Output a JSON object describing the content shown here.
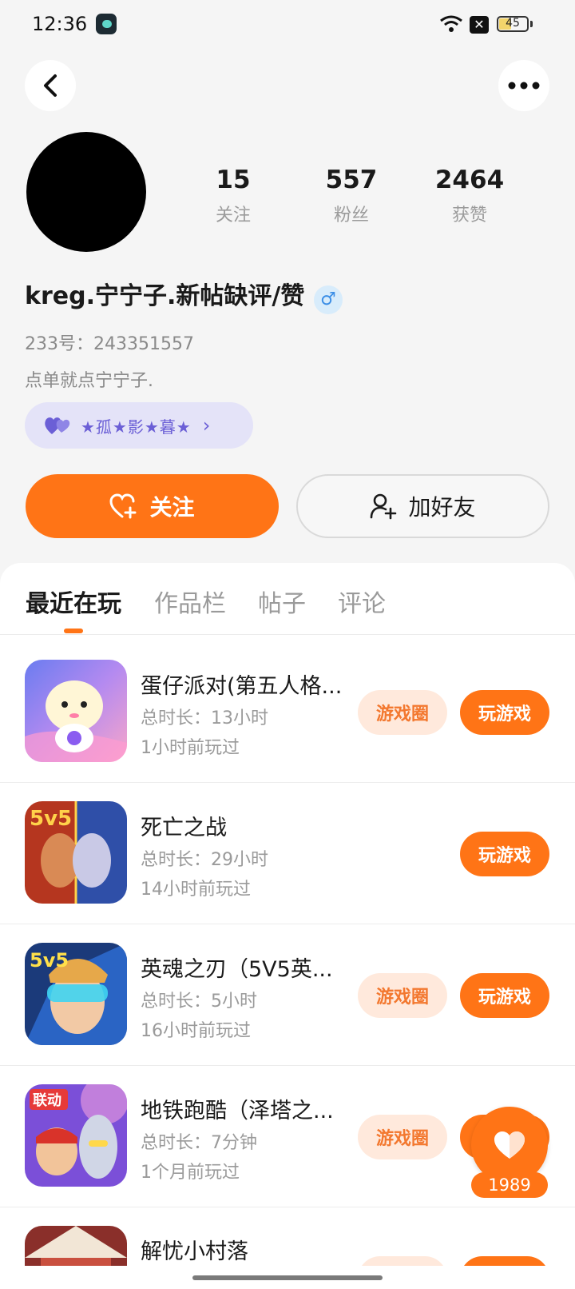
{
  "status_bar": {
    "time": "12:36",
    "battery": "45",
    "battery_level": 0.45,
    "notif": "✕"
  },
  "profile": {
    "stats": [
      {
        "num": "15",
        "label": "关注"
      },
      {
        "num": "557",
        "label": "粉丝"
      },
      {
        "num": "2464",
        "label": "获赞"
      }
    ],
    "nickname": "kreg.宁宁子.新帖缺评/赞",
    "gender_symbol": "♂",
    "uid": "233号：243351557",
    "bio": "点单就点宁宁子.",
    "badge": "★孤★影★暮★",
    "badge_arrow": "›"
  },
  "actions": {
    "follow": "关注",
    "add_friend": "加好友"
  },
  "tabs": [
    "最近在玩",
    "作品栏",
    "帖子",
    "评论"
  ],
  "games": [
    {
      "name": "蛋仔派对(第五人格...",
      "duration": "总时长：13小时",
      "last": "1小时前玩过",
      "has_circle": true
    },
    {
      "name": "死亡之战",
      "duration": "总时长：29小时",
      "last": "14小时前玩过",
      "has_circle": false
    },
    {
      "name": "英魂之刃（5V5英...",
      "duration": "总时长：5小时",
      "last": "16小时前玩过",
      "has_circle": true
    },
    {
      "name": "地铁跑酷（泽塔之...",
      "duration": "总时长：7分钟",
      "last": "1个月前玩过",
      "has_circle": true
    },
    {
      "name": "解忧小村落",
      "duration": "",
      "last": "",
      "has_circle": true
    }
  ],
  "game_buttons": {
    "circle": "游戏圈",
    "play": "玩游戏"
  },
  "float": {
    "count": "1989"
  },
  "colors": {
    "accent": "#ff7416",
    "accent_light": "#ffe9dc",
    "badge_bg": "#e4e3f8",
    "badge_text": "#6b5fd6"
  }
}
